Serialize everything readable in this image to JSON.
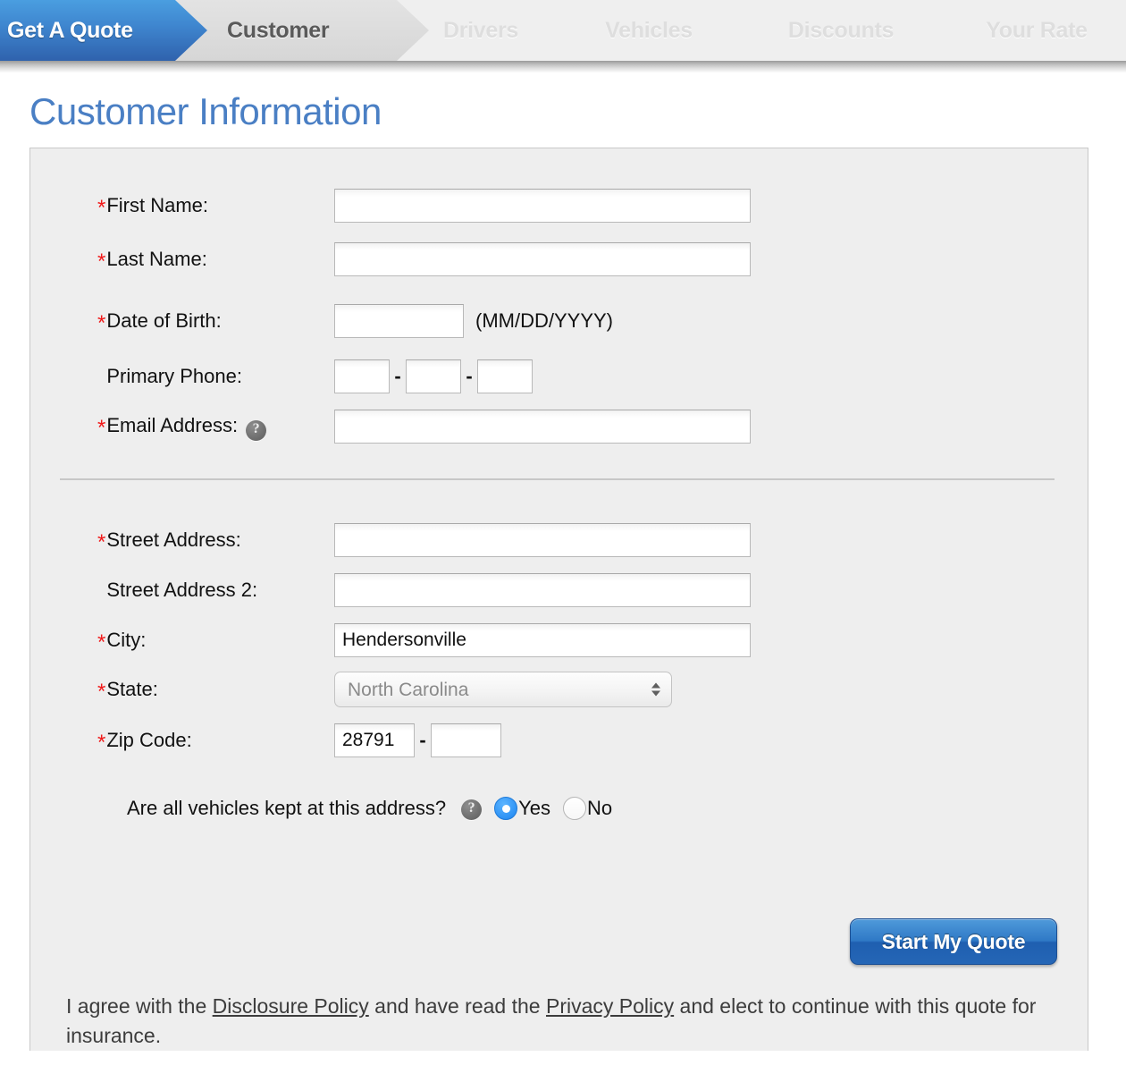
{
  "wizard": {
    "steps": [
      {
        "label": "Get A Quote",
        "state": "brand"
      },
      {
        "label": "Customer",
        "state": "current"
      },
      {
        "label": "Drivers",
        "state": "inactive"
      },
      {
        "label": "Vehicles",
        "state": "inactive"
      },
      {
        "label": "Discounts",
        "state": "inactive"
      },
      {
        "label": "Your Rate",
        "state": "inactive"
      }
    ],
    "active_color": "#3f86cf",
    "current_color": "#5a5a5a",
    "inactive_color": "#dedede"
  },
  "page": {
    "title": "Customer Information",
    "title_color": "#4a7fc4"
  },
  "form": {
    "required_marker": "*",
    "help_icon_glyph": "?",
    "fields": {
      "first_name": {
        "label": "First Name:",
        "value": "",
        "required": true
      },
      "last_name": {
        "label": "Last Name:",
        "value": "",
        "required": true
      },
      "date_of_birth": {
        "label": "Date of Birth:",
        "value": "",
        "required": true,
        "hint": "(MM/DD/YYYY)"
      },
      "primary_phone": {
        "label": "Primary Phone:",
        "required": false,
        "area": "",
        "prefix": "",
        "line": "",
        "separator": "-"
      },
      "email_address": {
        "label": "Email Address:",
        "value": "",
        "required": true,
        "has_help": true
      },
      "street_address": {
        "label": "Street Address:",
        "value": "",
        "required": true
      },
      "street_address_2": {
        "label": "Street Address 2:",
        "value": "",
        "required": false
      },
      "city": {
        "label": "City:",
        "value": "Hendersonville",
        "required": true
      },
      "state": {
        "label": "State:",
        "value": "North Carolina",
        "required": true,
        "options": [
          "North Carolina"
        ]
      },
      "zip_code": {
        "label": "Zip Code:",
        "zip5": "28791",
        "zip4": "",
        "required": true,
        "separator": "-"
      },
      "vehicles_kept": {
        "question": "Are all vehicles kept at this address?",
        "has_help": true,
        "selected": "Yes",
        "options": [
          {
            "label": "Yes",
            "checked": true
          },
          {
            "label": "No",
            "checked": false
          }
        ]
      }
    }
  },
  "actions": {
    "submit_label": "Start My Quote"
  },
  "agreement": {
    "text_1": "I agree with the ",
    "link_1": "Disclosure Policy",
    "text_2": " and have read the ",
    "link_2": "Privacy Policy",
    "text_3": " and elect to continue with this quote for insurance."
  }
}
